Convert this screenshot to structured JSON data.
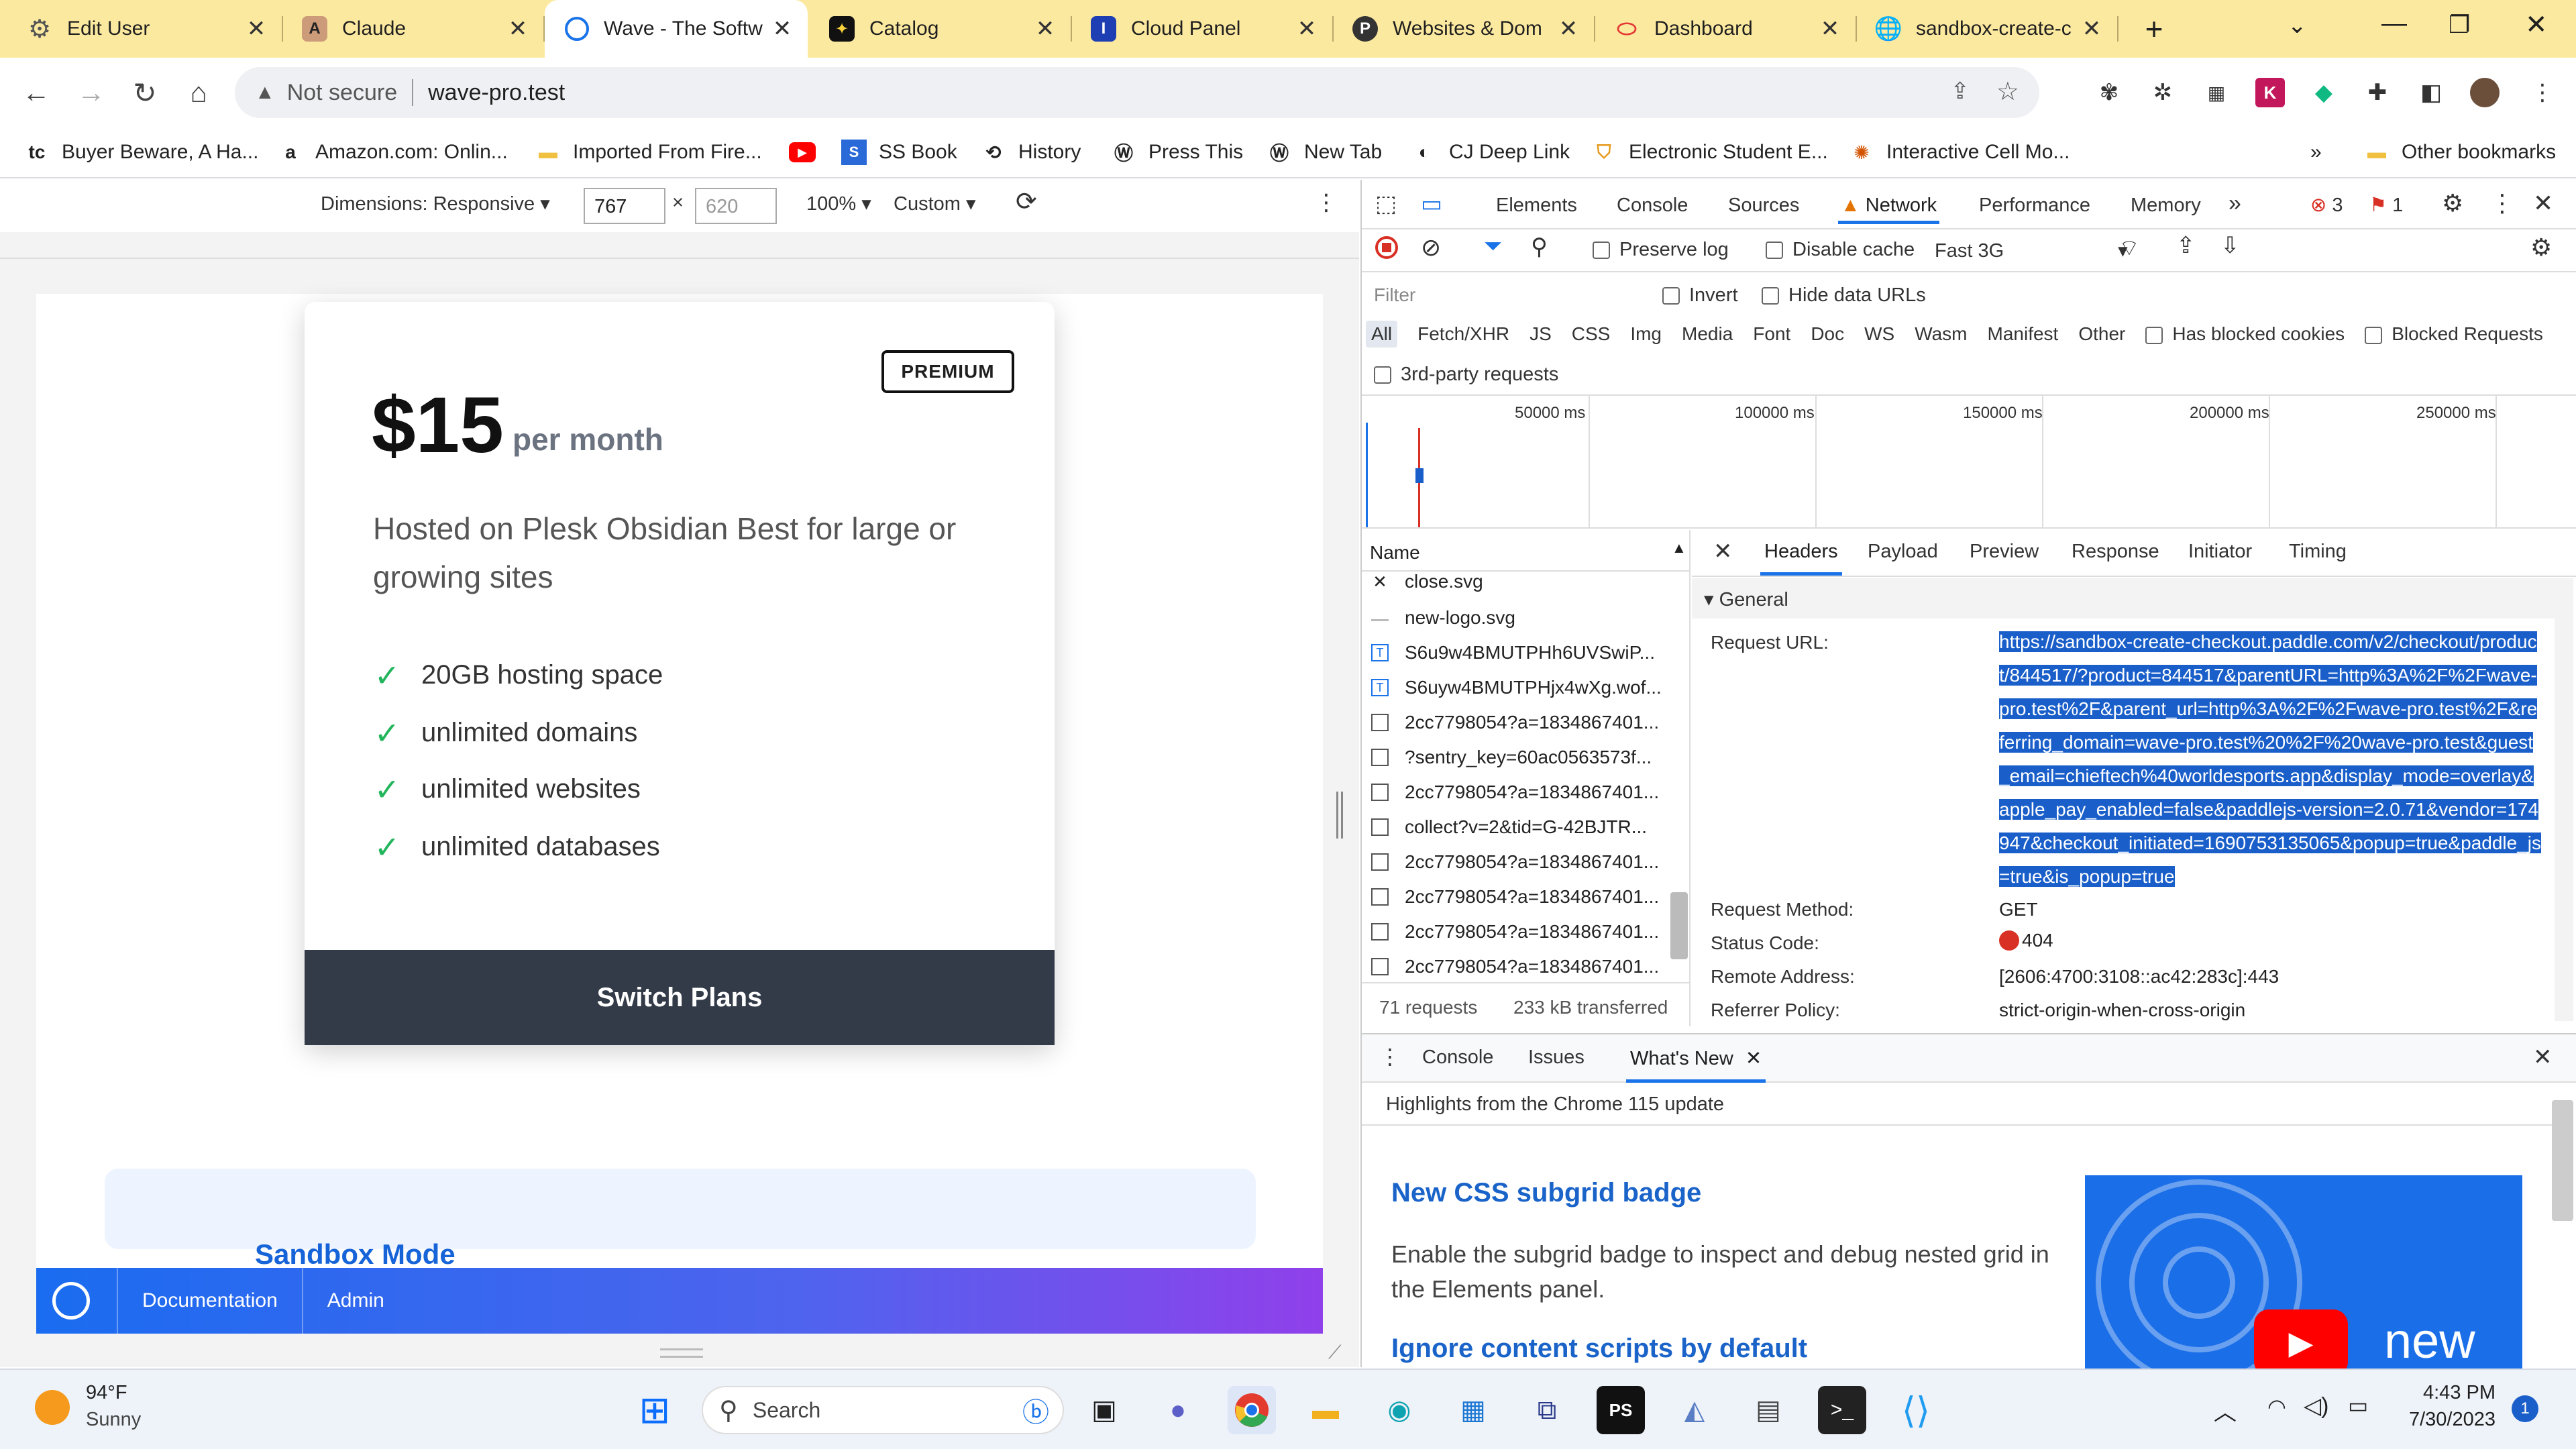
{
  "browser": {
    "tabs": [
      {
        "title": "Edit User",
        "icon": "gear-icon",
        "active": false
      },
      {
        "title": "Claude",
        "icon": "claude-icon",
        "active": false
      },
      {
        "title": "Wave - The Softw",
        "icon": "wave-icon",
        "active": true
      },
      {
        "title": "Catalog",
        "icon": "catalog-icon",
        "active": false
      },
      {
        "title": "Cloud Panel",
        "icon": "cloud-panel-icon",
        "active": false
      },
      {
        "title": "Websites & Dom",
        "icon": "plesk-icon",
        "active": false
      },
      {
        "title": "Dashboard",
        "icon": "dashboard-icon",
        "active": false
      },
      {
        "title": "sandbox-create-c",
        "icon": "globe-icon",
        "active": false
      }
    ],
    "address": {
      "security": "Not secure",
      "url": "wave-pro.test"
    },
    "bookmarks": [
      {
        "label": "Buyer Beware, A Ha...",
        "icon": "tc-icon"
      },
      {
        "label": "Amazon.com: Onlin...",
        "icon": "amazon-icon"
      },
      {
        "label": "Imported From Fire...",
        "icon": "folder-icon"
      },
      {
        "label": "",
        "icon": "youtube-icon"
      },
      {
        "label": "SS Book",
        "icon": "ss-icon"
      },
      {
        "label": "History",
        "icon": "history-icon"
      },
      {
        "label": "Press This",
        "icon": "wordpress-icon"
      },
      {
        "label": "New Tab",
        "icon": "wordpress-icon"
      },
      {
        "label": "CJ Deep Link",
        "icon": "cj-icon"
      },
      {
        "label": "Electronic Student E...",
        "icon": "shield-icon"
      },
      {
        "label": "Interactive Cell Mo...",
        "icon": "cell-icon"
      }
    ],
    "other_bookmarks": "Other bookmarks"
  },
  "device_toolbar": {
    "dimensions_label": "Dimensions: Responsive",
    "width": "767",
    "height": "620",
    "zoom": "100%",
    "throttle": "Custom"
  },
  "page": {
    "badge": "PREMIUM",
    "price": "$15",
    "period": "per month",
    "description": "Hosted on Plesk Obsidian Best for large or growing sites",
    "features": [
      "20GB hosting space",
      "unlimited domains",
      "unlimited websites",
      "unlimited databases"
    ],
    "button": "Switch Plans",
    "sandbox_title": "Sandbox Mode",
    "nav": [
      "Documentation",
      "Admin"
    ]
  },
  "devtools": {
    "tabs": [
      "Elements",
      "Console",
      "Sources",
      "Network",
      "Performance",
      "Memory"
    ],
    "active_tab": "Network",
    "errors": "3",
    "issues": "1",
    "toolbar": {
      "preserve_log": "Preserve log",
      "disable_cache": "Disable cache",
      "throttle": "Fast 3G"
    },
    "filter_placeholder": "Filter",
    "invert": "Invert",
    "hide_data_urls": "Hide data URLs",
    "type_filters": [
      "All",
      "Fetch/XHR",
      "JS",
      "CSS",
      "Img",
      "Media",
      "Font",
      "Doc",
      "WS",
      "Wasm",
      "Manifest",
      "Other"
    ],
    "has_blocked_cookies": "Has blocked cookies",
    "blocked_requests": "Blocked Requests",
    "third_party": "3rd-party requests",
    "timeline_labels": [
      "50000 ms",
      "100000 ms",
      "150000 ms",
      "200000 ms",
      "250000 ms"
    ],
    "name_header": "Name",
    "requests": [
      "close.svg",
      "new-logo.svg",
      "S6u9w4BMUTPHh6UVSwiP...",
      "S6uyw4BMUTPHjx4wXg.wof...",
      "2cc7798054?a=1834867401...",
      "?sentry_key=60ac0563573f...",
      "2cc7798054?a=1834867401...",
      "collect?v=2&tid=G-42BJTR...",
      "2cc7798054?a=1834867401...",
      "2cc7798054?a=1834867401...",
      "2cc7798054?a=1834867401...",
      "2cc7798054?a=1834867401..."
    ],
    "summary_requests": "71 requests",
    "summary_transferred": "233 kB transferred",
    "detail_tabs": [
      "Headers",
      "Payload",
      "Preview",
      "Response",
      "Initiator",
      "Timing"
    ],
    "general_label": "General",
    "general": {
      "request_url_label": "Request URL:",
      "request_url": "https://sandbox-create-checkout.paddle.com/v2/checkout/product/844517/?product=844517&parentURL=http%3A%2F%2Fwave-pro.test%2F&parent_url=http%3A%2F%2Fwave-pro.test%2F&referring_domain=wave-pro.test%20%2F%20wave-pro.test&guest_email=chieftech%40worldesports.app&display_mode=overlay&apple_pay_enabled=false&paddlejs-version=2.0.71&vendor=174947&checkout_initiated=1690753135065&popup=true&paddle_js=true&is_popup=true",
      "method_label": "Request Method:",
      "method": "GET",
      "status_label": "Status Code:",
      "status": "404",
      "remote_label": "Remote Address:",
      "remote": "[2606:4700:3108::ac42:283c]:443",
      "referrer_label": "Referrer Policy:",
      "referrer": "strict-origin-when-cross-origin"
    },
    "drawer_tabs": [
      "Console",
      "Issues",
      "What's New"
    ],
    "whats_new_intro": "Highlights from the Chrome 115 update",
    "whats_new_items": [
      {
        "title": "New CSS subgrid badge",
        "body": "Enable the subgrid badge to inspect and debug nested grid in the Elements panel."
      },
      {
        "title": "Ignore content scripts by default",
        "body": ""
      }
    ],
    "video_label": "new"
  },
  "taskbar": {
    "weather_temp": "94°F",
    "weather_desc": "Sunny",
    "search_placeholder": "Search",
    "time": "4:43 PM",
    "date": "7/30/2023",
    "notifications": "1"
  },
  "colors": {
    "tabbar": "#fce9a0",
    "accent_blue": "#1a73e8",
    "check_green": "#22b55c",
    "button_dark": "#333b48",
    "error_red": "#d93025"
  }
}
